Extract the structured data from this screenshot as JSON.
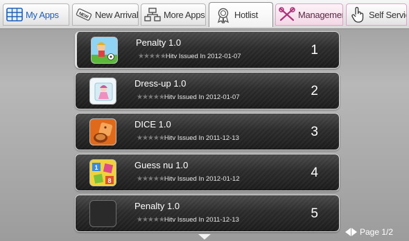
{
  "tabs": [
    {
      "label": "My Apps",
      "icon": "grid-icon",
      "active": false
    },
    {
      "label": "New Arrival",
      "icon": "new-tag-icon",
      "active": false
    },
    {
      "label": "More Apps",
      "icon": "network-icon",
      "active": false
    },
    {
      "label": "Hotlist",
      "icon": "award-ribbon-icon",
      "active": true
    },
    {
      "label": "Management",
      "icon": "tools-icon",
      "active": false
    },
    {
      "label": "Self Service",
      "icon": "hand-pointer-icon",
      "active": false
    }
  ],
  "apps": [
    {
      "title": "Penalty  1.0",
      "stars": "★★★★★",
      "issued": "Hitv Issued In 2012-01-07",
      "rank": "1",
      "icon": "soccer-kids-icon"
    },
    {
      "title": "Dress-up  1.0",
      "stars": "★★★★★",
      "issued": "Hitv Issued In 2012-01-07",
      "rank": "2",
      "icon": "dress-up-girl-icon"
    },
    {
      "title": "DICE  1.0",
      "stars": "★★★★★",
      "issued": "Hitv Issued In 2011-12-13",
      "rank": "3",
      "icon": "dice-icon"
    },
    {
      "title": "Guess nu  1.0",
      "stars": "★★★★★",
      "issued": "Hitv Issued In 2012-01-12",
      "rank": "4",
      "icon": "number-blocks-icon"
    },
    {
      "title": "Penalty  1.0",
      "stars": "★★★★★",
      "issued": "Hitv Issued In 2011-12-13",
      "rank": "5",
      "icon": "blank-icon"
    }
  ],
  "pager": {
    "label": "Page  1/2"
  },
  "colors": {
    "row_dark": "#1c1c1c",
    "tab_active": "#ffffff",
    "management_tab": "#f3d8e6",
    "link_blue": "#1d5fb8"
  }
}
